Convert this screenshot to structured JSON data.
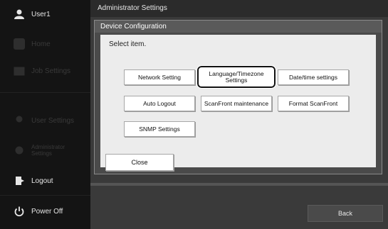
{
  "user": {
    "name": "User1"
  },
  "sidebar": {
    "items": [
      {
        "label": "Home",
        "icon": "home-icon"
      },
      {
        "label": "Job Settings",
        "icon": "job-settings-icon"
      },
      {
        "label": "User Settings",
        "icon": "user-settings-icon"
      },
      {
        "label": "Administrator Settings",
        "icon": "admin-settings-icon"
      },
      {
        "label": "Logout",
        "icon": "logout-icon"
      },
      {
        "label": "Power Off",
        "icon": "power-icon"
      }
    ]
  },
  "header": {
    "title": "Administrator Settings"
  },
  "dialog": {
    "title": "Device Configuration",
    "prompt": "Select item.",
    "buttons": {
      "network": "Network Setting",
      "language_line1": "Language/Timezone",
      "language_line2": "Settings",
      "datetime": "Date/time settings",
      "auto_logout": "Auto Logout",
      "maintenance": "ScanFront maintenance",
      "format": "Format ScanFront",
      "snmp": "SNMP Settings"
    },
    "selected": "Language/Timezone Settings",
    "close": "Close"
  },
  "footer": {
    "back": "Back"
  }
}
